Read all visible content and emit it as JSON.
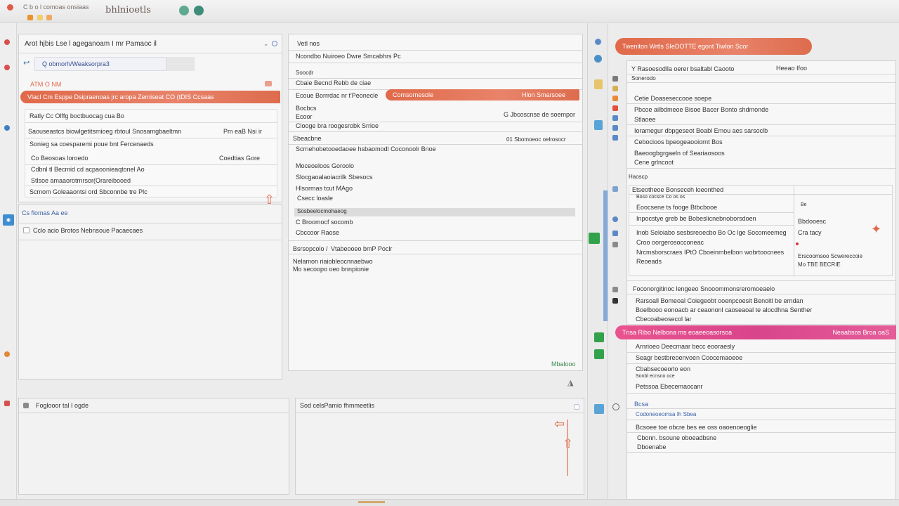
{
  "titlebar": {
    "title": "C b o l comoas onsiaas",
    "app_name": "bhlnioetls"
  },
  "left_panel": {
    "header": "Arot hjbis Lse l ageganoam I mr Pamaoc il",
    "search_value": "Q obmorh/Weaksorpra3",
    "banner_label": "ATM O NM",
    "banner_text": "Vlacl Cm Esppe Dsipraenoas jrc aropa Zemiseat CO (tDIS Ccsaas",
    "rows": [
      {
        "label": "Ratly Cc Olffg boctbuocag cua Bo",
        "value": ""
      },
      {
        "label": "Saouseastcs biowlgetitsmioeg rbtoul Snosamgbaeltmn",
        "value": "Pm eaB Nsi ir"
      },
      {
        "label": "Sonieg sa coesparemi poue bnt Fercenaeds",
        "value": ""
      },
      {
        "label": "Co Beosoas loroedo",
        "value": "Coedtias Gore"
      },
      {
        "label": "Cdbnl tl Becmid cd acpaoonieaqtonel Ao",
        "value": ""
      },
      {
        "label": "Stlsoe amaaorotrnrsor(Orareibooed",
        "value": ""
      },
      {
        "label": "Scmom Goleaaontsi ord Sbconnbe tre Plc",
        "value": ""
      }
    ],
    "section_title": "Cs flomas Aa ee",
    "section_row": "Cclo acio Brotos Nebnsoue Pacaecaes",
    "bottom_title": "Foglooor tal I ogde"
  },
  "middle_panel": {
    "header": "Vetl nos",
    "subheader": "Ncondbo Nuiroeo Dwre Smcabhrs Pc",
    "label_1": "Soocdr",
    "rows_1": [
      "Cbaie Becnd Rebb de ciae",
      "Ecoue Borrrdac nr t'Peonecle",
      "Bocbcs",
      "Ecoor"
    ],
    "banner_text": "Comsornesole",
    "banner_value": "Hlon Smarsoee",
    "side_value": "G Jbcoscnse de soempor",
    "row_after": "Clooge bra roogesrobk Srrioe",
    "section_2": "Sbeacbne",
    "section_2_value": "01 Sbomoeoc oelrosocr",
    "rows_2": [
      "Scrnehobetooedaoee hsbaomodl Coconoolr Bnoe",
      "Moceoeloos Goroolo",
      "Slocgaoalaoiacrilk Sbesocs",
      "Hlsormas tcut MAgo",
      "Csecc loasle"
    ],
    "highlight_row": "Sosbeelocmohaeog",
    "rows_3": [
      "C Broomocf socomb",
      "Cbccoor Raose"
    ],
    "field_label": "Bsrsopcolo /",
    "field_value": "Vtabeooeo bmP Poclr",
    "notes": [
      "Nelamon riaiobleocnnaebwo",
      "Mo secoopo oeo bnnpionie"
    ],
    "footer_link": "Mbalooo",
    "bottom_title": "Sod celsPamio fhmmeetlis"
  },
  "right_panel": {
    "banner": "Tweniton Wrtls  SIeDOTTE  egont   Tiwlon Scor",
    "header": "Y Rasoesodlla oerer bsaltabl Caooto",
    "header_right": "Heeao  Ifoo",
    "rows_1": [
      "Sonerodo",
      "Cetie Doaseseccooe soepe",
      "Pbcoe ailbdmeoe Bisoe Bacer Bonto shdmonde",
      "Stlaoee",
      "Ioramegur dbpgeseot Boabl Emou aes sarsoclb",
      "Cebocioos bpeogeaooiornt Bos",
      "Baeoogbgrgaeln of Seariaosoos",
      "Cene grlncoot"
    ],
    "section_1": "Haoscp",
    "sub_header": "Etseotheoe Bonseceh loeonthed",
    "sub_sub": "Boso cocsce    Co os os",
    "rows_2": [
      "Eoocsene ts fooge Btbcbooe",
      "Inpocstye greb be Bobeslicnebnoborsdoen",
      "Inob Seloiabo sesbsreoecbo Bo Oc lge Socomeemeg",
      "Croo oorgerosocconeac",
      "Nrcmsborscraes IPtO Cboeinmbelbon wobrtoocnees",
      "Reoeads"
    ],
    "side_values": [
      "Be",
      "Bbdooesc",
      "Cra tacy",
      "Erscoomsoo Scwereccoie",
      "Mo TBE BECRIE"
    ],
    "section_2": "Foconorgitinoc lengeeo Snooommonsreromoeaelo",
    "rows_3": [
      "Rarsoall Bomeoal Coiegeobt ooenpcoesit Benoitl be erndan",
      "Boelbooo eonoacb ar ceaononl caoseaoal te alocdhna Senther",
      "Cbecoabeosecol lar"
    ],
    "pink_banner": "Tnsa Ribo  Nelbona ms eoaeeoasorsoa",
    "pink_right": "Neaabsos Broa oaS",
    "rows_4": [
      "Arnrioeo Deecmaar becc eooraesly",
      "Seagr bestbreoenvoen Coocemaoeoe",
      "Cbabsecoeorlo eon",
      "Sonbl ecnsno oce",
      "Petssoa Ebecemaocanr"
    ],
    "section_3": "Bcsa",
    "section_3_sub": "Codoneoeomsa Ih Sbea",
    "rows_5": [
      "Bcsoee toe obcre bes ee oss oaoenoeoglie",
      "Cbonn. bsoune oboeadbsne",
      "Dboenabe"
    ]
  },
  "colors": {
    "accent_orange": "#e06a4b",
    "accent_pink": "#e2529a",
    "accent_green": "#31a24a",
    "accent_blue": "#4a8fd4"
  }
}
